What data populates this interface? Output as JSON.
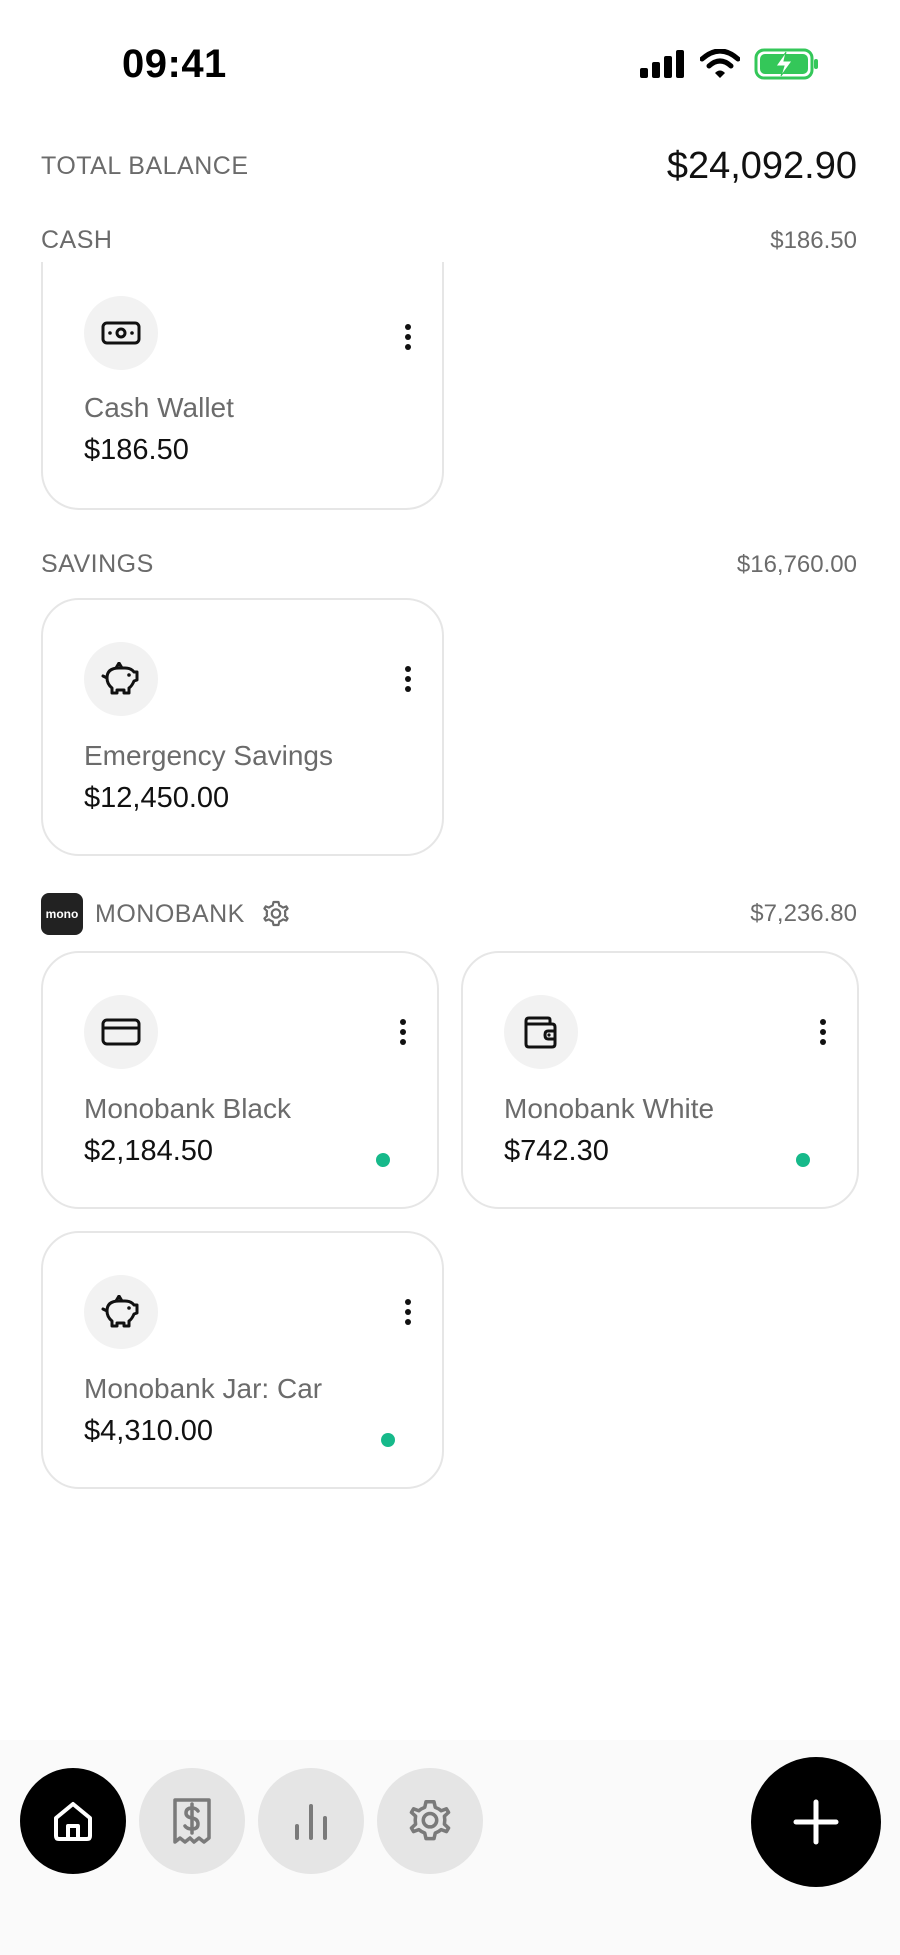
{
  "status_bar": {
    "time": "09:41"
  },
  "summary": {
    "total_label": "TOTAL BALANCE",
    "total_value": "$24,092.90"
  },
  "groups": [
    {
      "name": "CASH",
      "total": "$186.50",
      "accounts": [
        {
          "name": "Cash Wallet",
          "balance": "$186.50",
          "icon": "cash-icon",
          "synced": false
        }
      ]
    },
    {
      "name": "SAVINGS",
      "total": "$16,760.00",
      "accounts": [
        {
          "name": "Emergency Savings",
          "balance": "$12,450.00",
          "icon": "piggy-bank-icon",
          "synced": false
        }
      ]
    },
    {
      "name": "MONOBANK",
      "logo_text": "mono",
      "total": "$7,236.80",
      "accounts": [
        {
          "name": "Monobank Black",
          "balance": "$2,184.50",
          "icon": "credit-card-icon",
          "synced": true
        },
        {
          "name": "Monobank White",
          "balance": "$742.30",
          "icon": "wallet-icon",
          "synced": true
        },
        {
          "name": "Monobank Jar: Car",
          "balance": "$4,310.00",
          "icon": "piggy-bank-icon",
          "synced": true
        }
      ]
    }
  ],
  "nav": [
    {
      "name": "home",
      "icon": "home-icon",
      "active": true
    },
    {
      "name": "transactions",
      "icon": "receipt-dollar-icon",
      "active": false
    },
    {
      "name": "reports",
      "icon": "bar-chart-icon",
      "active": false
    },
    {
      "name": "settings",
      "icon": "gear-icon",
      "active": false
    }
  ],
  "colors": {
    "accent": "#000000",
    "sync_dot": "#16b98a",
    "battery": "#34c759",
    "muted_text": "#6b6b6b",
    "card_border": "#e6e6e6"
  }
}
